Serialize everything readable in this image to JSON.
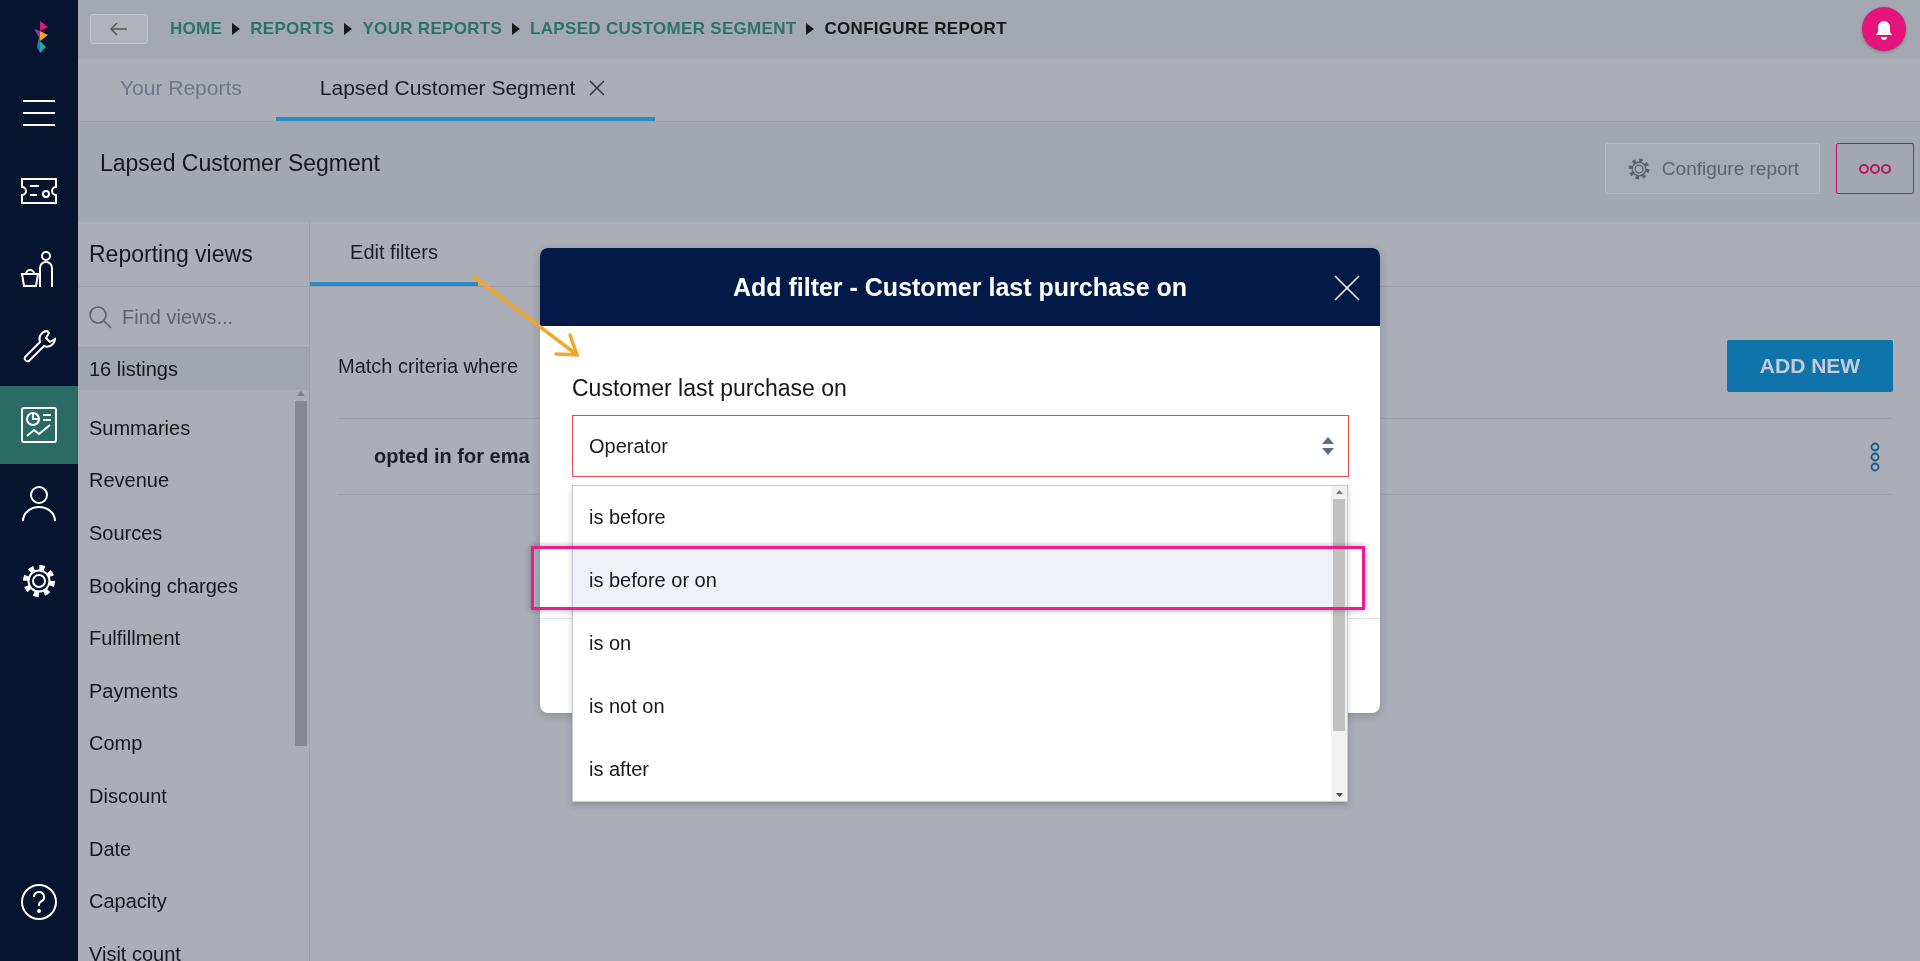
{
  "nav_items": [
    {
      "kind": "menu",
      "selected": false
    },
    {
      "kind": "ticket",
      "selected": false
    },
    {
      "kind": "basket-person",
      "selected": false
    },
    {
      "kind": "wrench",
      "selected": false
    },
    {
      "kind": "report",
      "selected": true
    },
    {
      "kind": "person",
      "selected": false
    },
    {
      "kind": "gear",
      "selected": false
    },
    {
      "kind": "help",
      "selected": false
    }
  ],
  "breadcrumbs": [
    {
      "label": "HOME",
      "current": false
    },
    {
      "label": "REPORTS",
      "current": false
    },
    {
      "label": "YOUR REPORTS",
      "current": false
    },
    {
      "label": "LAPSED CUSTOMER SEGMENT",
      "current": false
    },
    {
      "label": "CONFIGURE REPORT",
      "current": true
    }
  ],
  "tabs": [
    {
      "label": "Your Reports",
      "selected": false,
      "closable": false
    },
    {
      "label": "Lapsed Customer Segment",
      "selected": true,
      "closable": true
    }
  ],
  "report": {
    "title": "Lapsed Customer Segment",
    "configure_button": "Configure report"
  },
  "reporting_views": {
    "title": "Reporting views",
    "search_placeholder": "Find views...",
    "count": "16 listings",
    "items": [
      "Summaries",
      "Revenue",
      "Sources",
      "Booking charges",
      "Fulfillment",
      "Payments",
      "Comp",
      "Discount",
      "Date",
      "Capacity",
      "Visit count"
    ]
  },
  "content_tabs": [
    {
      "label": "Edit filters",
      "selected": true
    }
  ],
  "filters": {
    "match_label": "Match criteria where",
    "add_button": "ADD NEW",
    "rows": [
      "opted in for ema"
    ]
  },
  "dialog": {
    "title": "Add filter - Customer last purchase on",
    "field_label": "Customer last purchase on",
    "select": {
      "value": "Operator",
      "invalid": true
    },
    "options": [
      {
        "label": "is before",
        "selected": false
      },
      {
        "label": "is before or on",
        "selected": true
      },
      {
        "label": "is on",
        "selected": false
      },
      {
        "label": "is not on",
        "selected": false
      },
      {
        "label": "is after",
        "selected": false
      }
    ]
  }
}
